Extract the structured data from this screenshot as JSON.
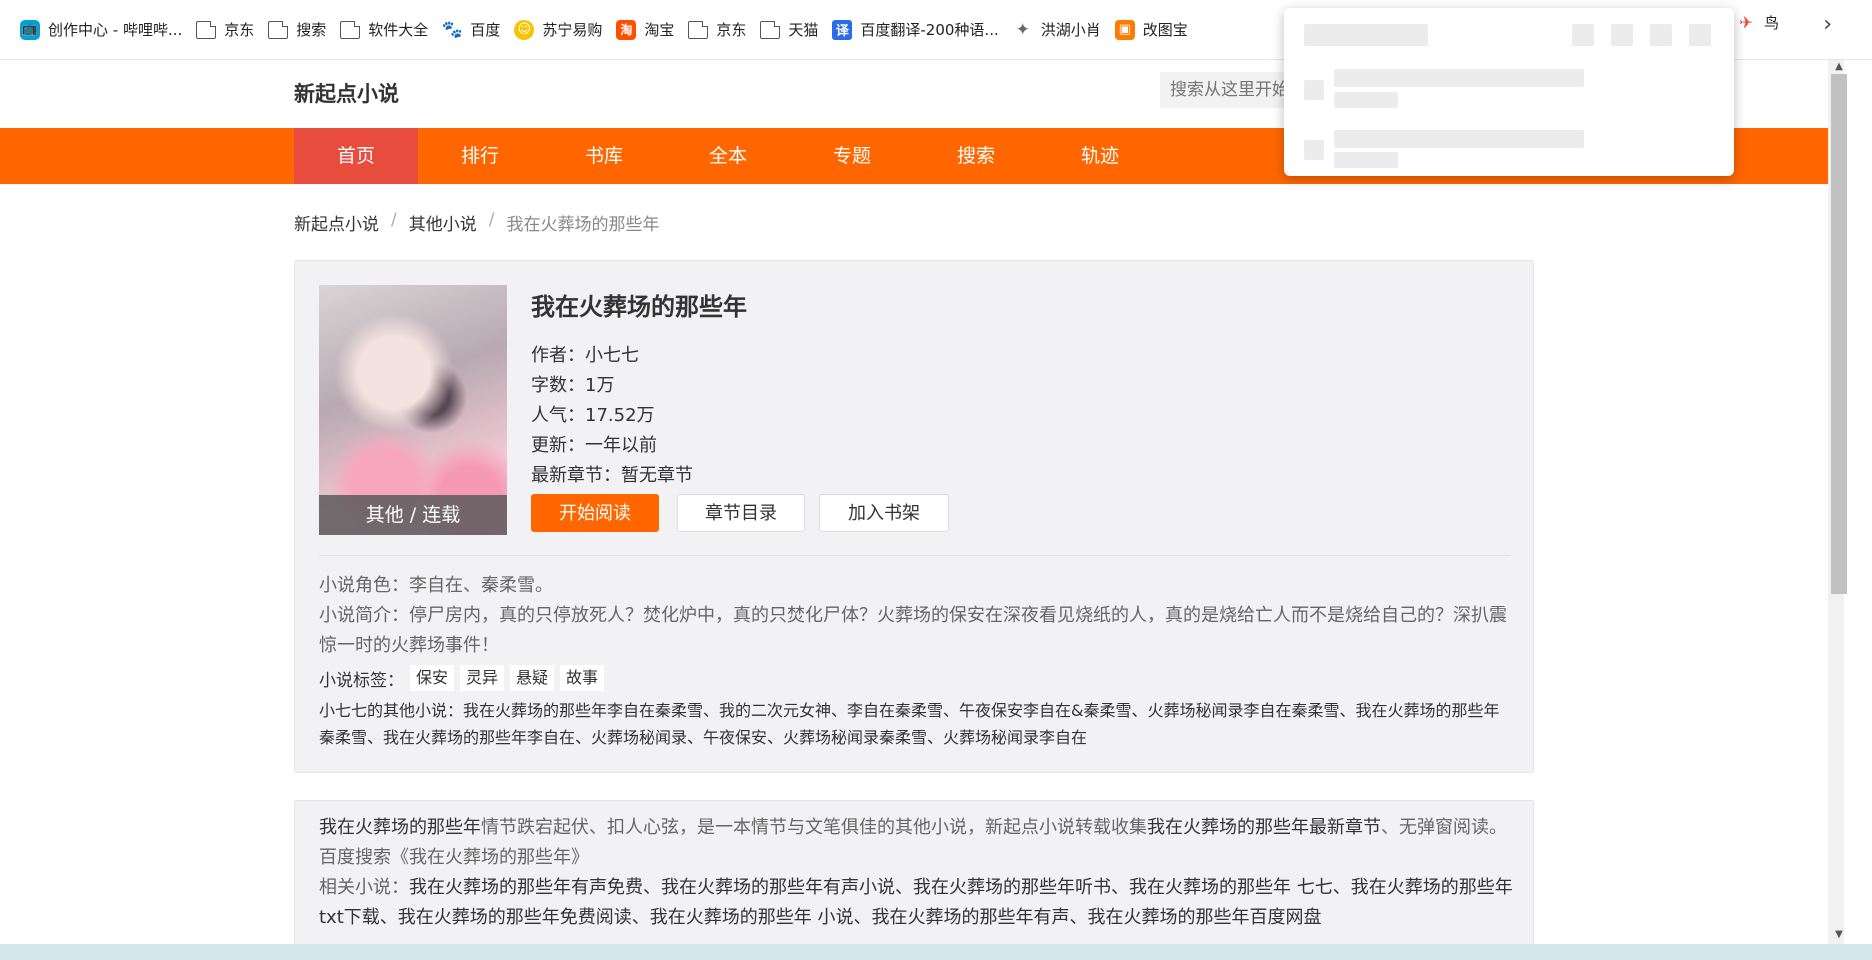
{
  "bookmarks": [
    {
      "label": "创作中心 - 哔哩哔...",
      "icon": "bilibili-icon",
      "icon_char": "📺"
    },
    {
      "label": "京东",
      "icon": "page-icon",
      "icon_char": ""
    },
    {
      "label": "搜索",
      "icon": "page-icon",
      "icon_char": ""
    },
    {
      "label": "软件大全",
      "icon": "page-icon",
      "icon_char": ""
    },
    {
      "label": "百度",
      "icon": "baidu-icon",
      "icon_char": "🐾"
    },
    {
      "label": "苏宁易购",
      "icon": "suning-icon",
      "icon_char": "☺"
    },
    {
      "label": "淘宝",
      "icon": "taobao-icon",
      "icon_char": "淘"
    },
    {
      "label": "京东",
      "icon": "page-icon",
      "icon_char": ""
    },
    {
      "label": "天猫",
      "icon": "page-icon",
      "icon_char": ""
    },
    {
      "label": "百度翻译-200种语...",
      "icon": "fanyi-icon",
      "icon_char": "译"
    },
    {
      "label": "洪湖小肖",
      "icon": "honghu-icon",
      "icon_char": "✦"
    },
    {
      "label": "改图宝",
      "icon": "gaitubao-icon",
      "icon_char": "▣"
    }
  ],
  "bookmark_tail": {
    "label": "鸟",
    "icon_char": "✈"
  },
  "bookmark_more": "›",
  "site": {
    "logo": "新起点小说",
    "search_placeholder": "搜索从这里开始"
  },
  "nav": [
    "首页",
    "排行",
    "书库",
    "全本",
    "专题",
    "搜索",
    "轨迹"
  ],
  "breadcrumb": {
    "home": "新起点小说",
    "category": "其他小说",
    "current": "我在火葬场的那些年",
    "sep": "/"
  },
  "book": {
    "title": "我在火葬场的那些年",
    "cover_label": "其他 / 连载",
    "author": "作者：小七七",
    "words": "字数：1万",
    "popularity": "人气：17.52万",
    "updated": "更新：一年以前",
    "latest": "最新章节：暂无章节",
    "btn_read": "开始阅读",
    "btn_toc": "章节目录",
    "btn_shelf": "加入书架",
    "roles": "小说角色：李自在、秦柔雪。",
    "intro": "小说简介：停尸房内，真的只停放死人？焚化炉中，真的只焚化尸体？火葬场的保安在深夜看见烧纸的人，真的是烧给亡人而不是烧给自己的？深扒震惊一时的火葬场事件！",
    "tags_label": "小说标签：",
    "tags": [
      "保安",
      "灵异",
      "悬疑",
      "故事"
    ],
    "other_books": "小七七的其他小说：我在火葬场的那些年李自在秦柔雪、我的二次元女神、李自在秦柔雪、午夜保安李自在&秦柔雪、火葬场秘闻录李自在秦柔雪、我在火葬场的那些年秦柔雪、我在火葬场的那些年李自在、火葬场秘闻录、午夜保安、火葬场秘闻录秦柔雪、火葬场秘闻录李自在"
  },
  "seo": {
    "p1_dark_a": "我在火葬场的那些年",
    "p1_light_a": "情节跌宕起伏、扣人心弦，是一本情节与文笔俱佳的其他小说，新起点小说转载收集",
    "p1_dark_b": "我在火葬场的那些年最新章节",
    "p1_light_b": "、无弹窗阅读。百度搜索《我在火葬场的那些年》",
    "p2_label": "相关小说：",
    "p2_text": "我在火葬场的那些年有声免费、我在火葬场的那些年有声小说、我在火葬场的那些年听书、我在火葬场的那些年 七七、我在火葬场的那些年txt下载、我在火葬场的那些年免费阅读、我在火葬场的那些年 小说、我在火葬场的那些年有声、我在火葬场的那些年百度网盘"
  },
  "colors": {
    "accent": "#ff6600",
    "nav_active": "#e84c3d",
    "card_bg": "#f2f2f4"
  }
}
